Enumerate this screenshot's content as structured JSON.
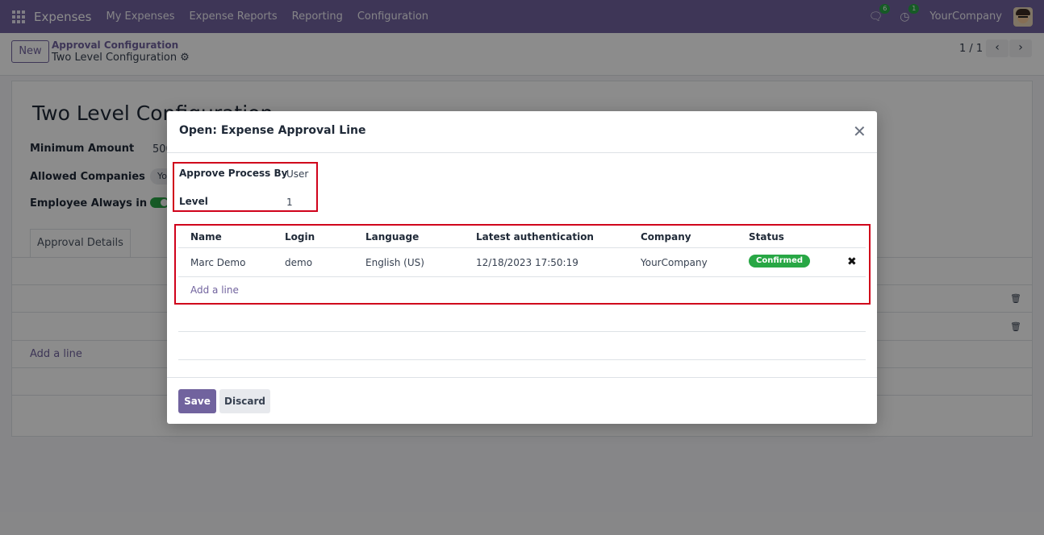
{
  "navbar": {
    "app_name": "Expenses",
    "menu": [
      "My Expenses",
      "Expense Reports",
      "Reporting",
      "Configuration"
    ],
    "messages_count": "6",
    "activities_count": "1",
    "company": "YourCompany"
  },
  "control_panel": {
    "new_label": "New",
    "breadcrumb_parent": "Approval Configuration",
    "breadcrumb_current": "Two Level Configuration",
    "pager": "1 / 1"
  },
  "form": {
    "title": "Two Level Configuration",
    "min_amount_label": "Minimum Amount",
    "min_amount_value": "500",
    "allowed_companies_label": "Allowed Companies",
    "allowed_companies_tag": "Yo",
    "employee_cc_label": "Employee Always in CC",
    "tab_label": "Approval Details",
    "add_line": "Add a line"
  },
  "modal": {
    "title": "Open: Expense Approval Line",
    "approve_process_label": "Approve Process By",
    "approve_process_value": "User",
    "level_label": "Level",
    "level_value": "1",
    "columns": [
      "Name",
      "Login",
      "Language",
      "Latest authentication",
      "Company",
      "Status"
    ],
    "rows": [
      {
        "name": "Marc Demo",
        "login": "demo",
        "language": "English (US)",
        "latest_auth": "12/18/2023 17:50:19",
        "company": "YourCompany",
        "status": "Confirmed"
      }
    ],
    "add_line": "Add a line",
    "save_label": "Save",
    "discard_label": "Discard"
  },
  "colors": {
    "brand": "#71639e",
    "highlight": "#d0021b",
    "status_confirmed": "#28a745"
  }
}
